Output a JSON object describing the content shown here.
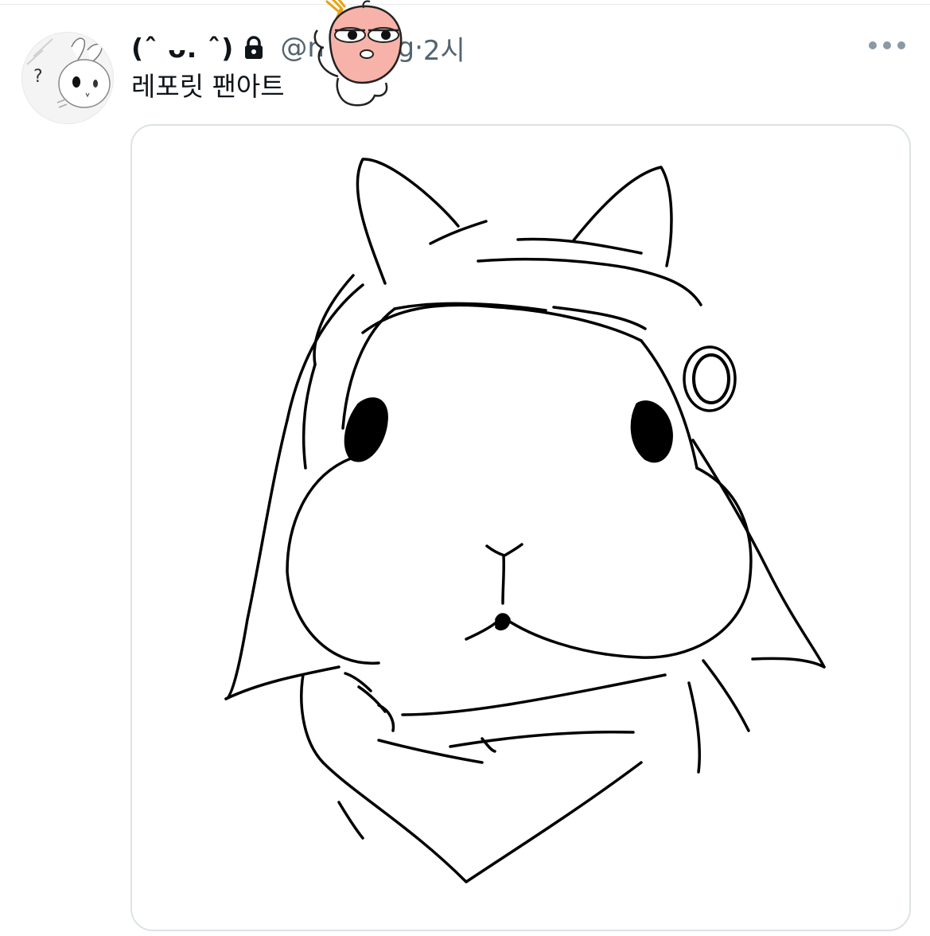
{
  "tweet": {
    "display_name": "(ˆ ᴗ. ˆ)",
    "handle": "@n",
    "handle_tail": "ng",
    "separator": " · ",
    "time": "2시",
    "text": "레포릿 팬아트",
    "protected": true,
    "icons": {
      "lock": "lock-icon",
      "more": "more-horizontal-icon",
      "avatar": "bunny-avatar",
      "sticker": "peach-character-sticker"
    }
  },
  "media": {
    "description_icon": "bunny-drawing",
    "colors": {
      "stroke": "#000000",
      "card_border": "#dde2e5"
    }
  },
  "colors": {
    "secondary_text": "#536471",
    "primary_text": "#0f1419",
    "sticker_face": "#f7b3a9"
  }
}
